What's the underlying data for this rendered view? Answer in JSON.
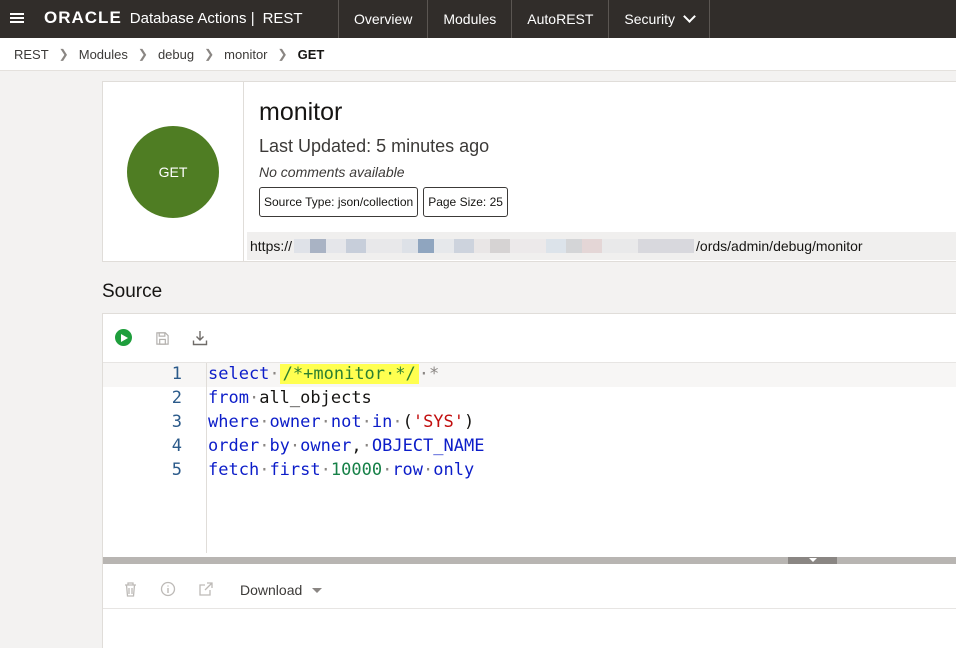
{
  "topbar": {
    "logo": "ORACLE",
    "app_name": "Database Actions |",
    "section": "REST",
    "nav": [
      "Overview",
      "Modules",
      "AutoREST",
      "Security"
    ]
  },
  "breadcrumb": [
    "REST",
    "Modules",
    "debug",
    "monitor",
    "GET"
  ],
  "handler": {
    "method": "GET",
    "title": "monitor",
    "last_updated": "Last Updated: 5 minutes ago",
    "comments": "No comments available",
    "source_type": "Source Type: json/collection",
    "page_size": "Page Size: 25",
    "url_prefix": "https://",
    "url_suffix": "/ords/admin/debug/monitor"
  },
  "source": {
    "title": "Source",
    "line_numbers": [
      "1",
      "2",
      "3",
      "4",
      "5"
    ]
  },
  "results_toolbar": {
    "download_label": "Download"
  },
  "colors": {
    "topbar": "#312d2a",
    "method_get": "#4f7d23",
    "run_button": "#1e9e3c",
    "comment_highlight": "#ffff50"
  }
}
